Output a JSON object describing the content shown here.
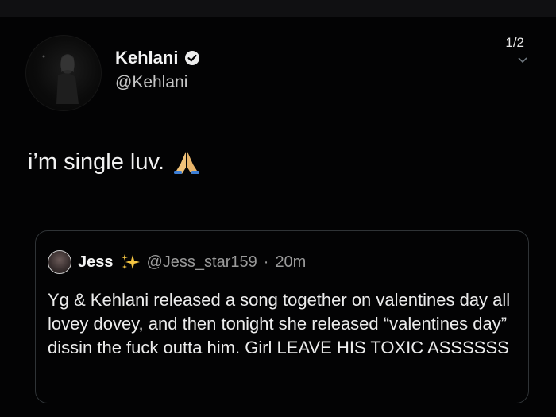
{
  "counter": "1/2",
  "author": {
    "name": "Kehlani",
    "handle": "@Kehlani",
    "verified": true
  },
  "tweet": {
    "text": "i’m single luv.",
    "emoji_icon": "folded-hands-icon"
  },
  "quote": {
    "name": "Jess",
    "sparkles_icon": "sparkles-icon",
    "handle": "@Jess_star159",
    "separator": "·",
    "time": "20m",
    "body": "Yg & Kehlani released a song together on valentines day all lovey dovey, and then tonight she released “valentines day” dissin the fuck outta him. Girl LEAVE HIS TOXIC ASSSSSS"
  },
  "colors": {
    "background": "#000000",
    "border": "#2f3336",
    "sparkle": "#f5c542"
  }
}
